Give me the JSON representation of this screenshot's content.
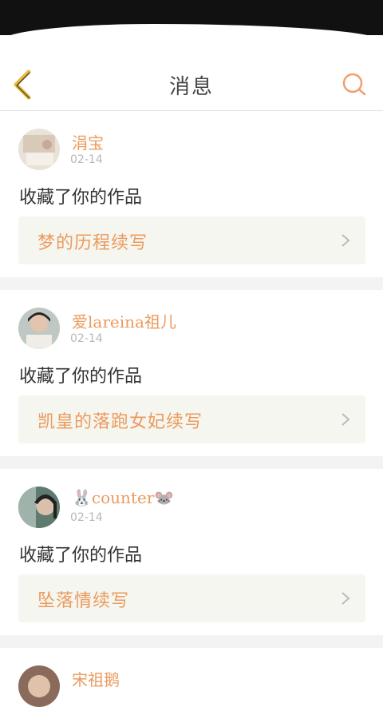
{
  "header": {
    "title": "消息",
    "back_icon": "chevron-left-icon",
    "search_icon": "search-icon",
    "accent": "#e8b83a",
    "search_color": "#f0a070"
  },
  "colors": {
    "name": "#ec9a5e",
    "work": "#ec9a5e",
    "date": "#b8b8b8",
    "card_bg": "#f5f6ef",
    "separator": "#f3f3f3"
  },
  "messages": [
    {
      "username": "涓宝",
      "date": "02-14",
      "action": "收藏了你的作品",
      "work_title": "梦的历程续写"
    },
    {
      "username": "爱lareina祖儿",
      "date": "02-14",
      "action": "收藏了你的作品",
      "work_title": "凯皇的落跑女妃续写"
    },
    {
      "username": "🐰counter🐭",
      "date": "02-14",
      "action": "收藏了你的作品",
      "work_title": "坠落情续写"
    },
    {
      "username": "宋祖鹅"
    }
  ]
}
